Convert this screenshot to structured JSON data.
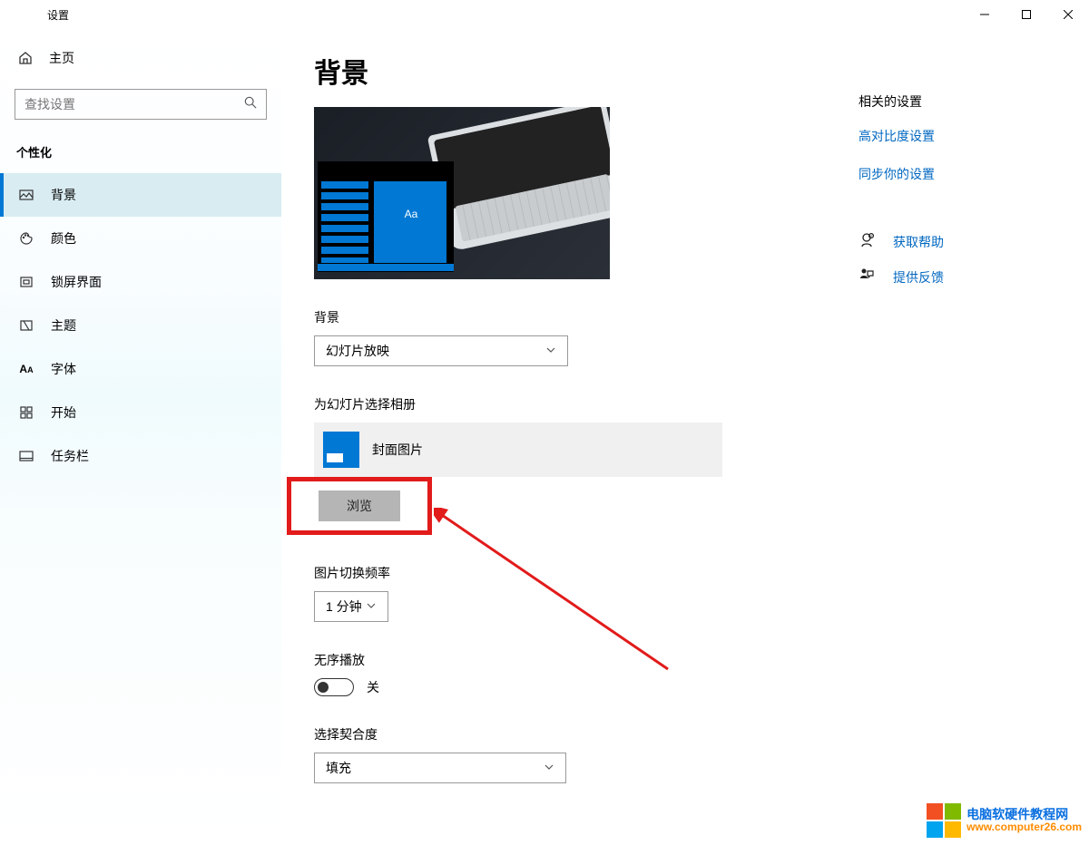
{
  "window": {
    "title": "设置"
  },
  "sidebar": {
    "home": "主页",
    "search_placeholder": "查找设置",
    "section": "个性化",
    "items": [
      {
        "label": "背景"
      },
      {
        "label": "颜色"
      },
      {
        "label": "锁屏界面"
      },
      {
        "label": "主题"
      },
      {
        "label": "字体"
      },
      {
        "label": "开始"
      },
      {
        "label": "任务栏"
      }
    ]
  },
  "main": {
    "title": "背景",
    "preview_text": "Aa",
    "bg_label": "背景",
    "bg_value": "幻灯片放映",
    "album_label": "为幻灯片选择相册",
    "album_value": "封面图片",
    "browse": "浏览",
    "freq_label": "图片切换频率",
    "freq_value": "1 分钟",
    "shuffle_label": "无序播放",
    "shuffle_value": "关",
    "fit_label": "选择契合度",
    "fit_value": "填充"
  },
  "right": {
    "title": "相关的设置",
    "links": [
      "高对比度设置",
      "同步你的设置"
    ],
    "help": "获取帮助",
    "feedback": "提供反馈"
  },
  "watermark": {
    "line1": "电脑软硬件教程网",
    "line2": "www.computer26.com"
  }
}
